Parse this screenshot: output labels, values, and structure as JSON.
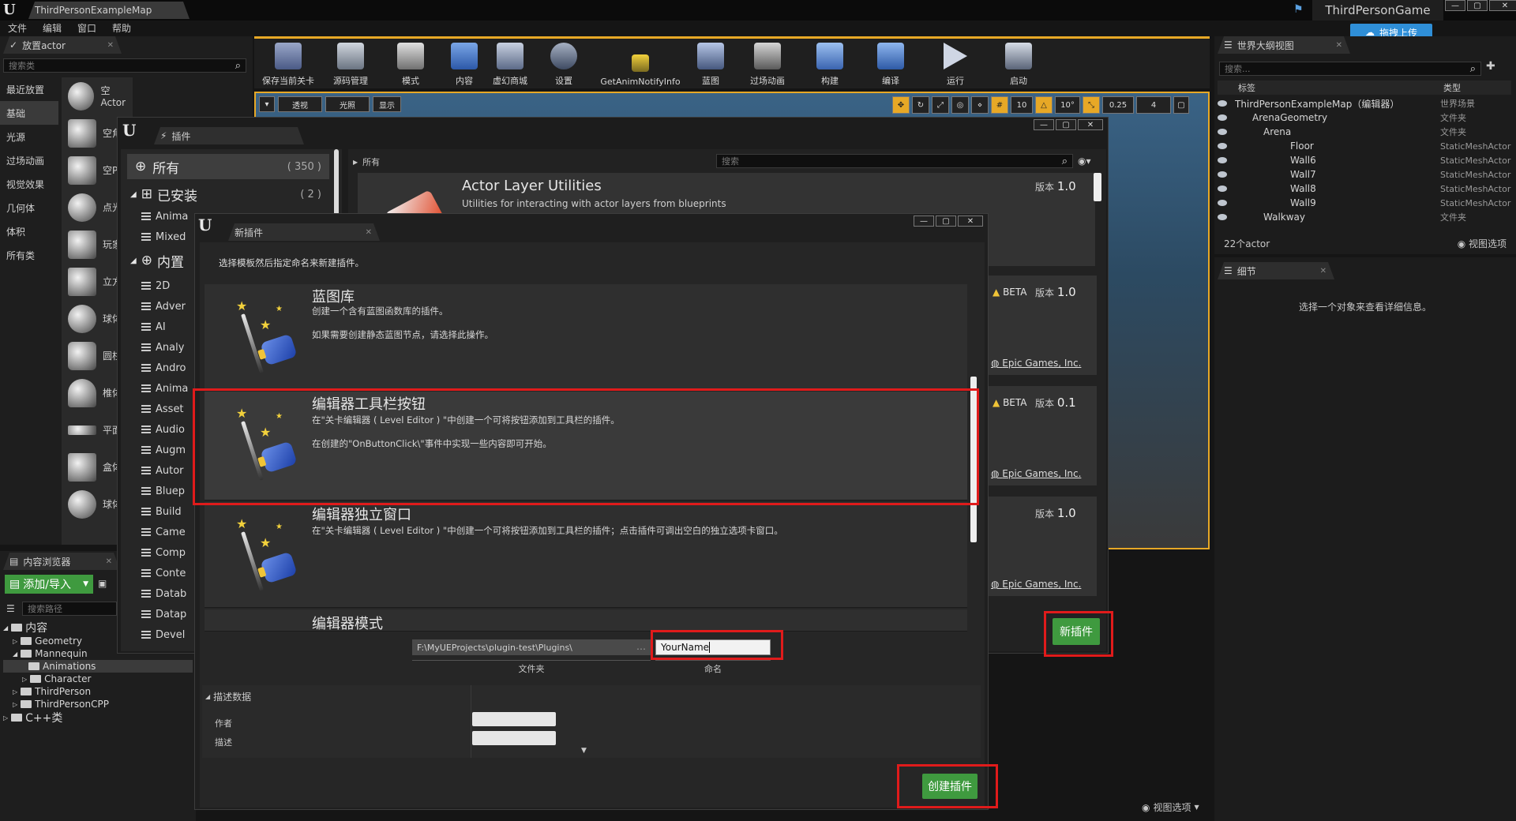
{
  "titlebar": {
    "map_tab": "ThirdPersonExampleMap",
    "project": "ThirdPersonGame",
    "upload": "拖拽上传"
  },
  "menu": [
    "文件",
    "编辑",
    "窗口",
    "帮助"
  ],
  "place_panel": {
    "tab": "放置actor",
    "search_placeholder": "搜索类",
    "categories": [
      "最近放置",
      "基础",
      "光源",
      "过场动画",
      "视觉效果",
      "几何体",
      "体积",
      "所有类"
    ],
    "items": [
      "空Actor",
      "空角",
      "空P",
      "点光",
      "玩家",
      "立方",
      "球体",
      "圆柱",
      "椎体",
      "平面",
      "盒体",
      "球体"
    ]
  },
  "toolbar": [
    "保存当前关卡",
    "源码管理",
    "模式",
    "内容",
    "虚幻商城",
    "设置",
    "GetAnimNotifyInfo",
    "蓝图",
    "过场动画",
    "构建",
    "编译",
    "运行",
    "启动"
  ],
  "viewport": {
    "perspective": "透视",
    "lit": "光照",
    "show": "显示",
    "grid": "10",
    "rot": "10°",
    "scale": "0.25",
    "cam": "4"
  },
  "plugins_window": {
    "tab": "插件",
    "all_label": "所有",
    "all_count": "( 350 )",
    "installed_label": "已安装",
    "installed_count": "( 2 )",
    "builtin_label": "内置",
    "installed_children": [
      "Anima",
      "Mixed"
    ],
    "builtin_children": [
      "2D",
      "Adver",
      "AI",
      "Analy",
      "Andro",
      "Anima",
      "Asset",
      "Audio",
      "Augm",
      "Autor",
      "Bluep",
      "Build",
      "Came",
      "Comp",
      "Conte",
      "Datab",
      "Datap",
      "Devel"
    ],
    "breadcrumb": "所有",
    "search_placeholder": "搜索",
    "first_plugin": {
      "title": "Actor Layer Utilities",
      "desc": "Utilities for interacting with actor layers from blueprints",
      "version_label": "版本",
      "version": "1.0"
    },
    "cards": [
      {
        "beta": "BETA",
        "version_label": "版本",
        "version": "1.0",
        "publisher": "Epic Games, Inc."
      },
      {
        "beta": "BETA",
        "version_label": "版本",
        "version": "0.1",
        "publisher": "Epic Games, Inc."
      },
      {
        "beta": "",
        "version_label": "版本",
        "version": "1.0",
        "publisher": "Epic Games, Inc."
      }
    ],
    "new_plugin_button": "新插件"
  },
  "new_plugin_dialog": {
    "tab": "新插件",
    "instructions": "选择模板然后指定命名来新建插件。",
    "templates": [
      {
        "title": "蓝图库",
        "desc1": "创建一个含有蓝图函数库的插件。",
        "desc2": "如果需要创建静态蓝图节点，请选择此操作。"
      },
      {
        "title": "编辑器工具栏按钮",
        "desc1": "在\"关卡编辑器 ( Level Editor ) \"中创建一个可将按钮添加到工具栏的插件。",
        "desc2": "在创建的\"OnButtonClick\\\"事件中实现一些内容即可开始。"
      },
      {
        "title": "编辑器独立窗口",
        "desc1": "在\"关卡编辑器 ( Level Editor ) \"中创建一个可将按钮添加到工具栏的插件；点击插件可调出空白的独立选项卡窗口。",
        "desc2": ""
      },
      {
        "title": "编辑器模式",
        "desc1": "",
        "desc2": ""
      }
    ],
    "path_value": "F:\\MyUEProjects\\plugin-test\\Plugins\\",
    "path_label": "文件夹",
    "name_value": "YourName",
    "name_label": "命名",
    "descriptor_header": "描述数据",
    "author_label": "作者",
    "desc_label": "描述",
    "create_button": "创建插件"
  },
  "content_browser": {
    "tab": "内容浏览器",
    "add_import": "添加/导入",
    "search_placeholder": "搜索路径",
    "root": "内容",
    "tree": [
      "Geometry",
      "Mannequin",
      "Animations",
      "Character",
      "ThirdPerson",
      "ThirdPersonCPP"
    ],
    "cpp": "C++类"
  },
  "outliner": {
    "tab": "世界大纲视图",
    "search_placeholder": "搜索...",
    "col_label": "标签",
    "col_type": "类型",
    "rows": [
      {
        "label": "ThirdPersonExampleMap（编辑器）",
        "type": "世界场景"
      },
      {
        "label": "ArenaGeometry",
        "type": "文件夹"
      },
      {
        "label": "Arena",
        "type": "文件夹"
      },
      {
        "label": "Floor",
        "type": "StaticMeshActor"
      },
      {
        "label": "Wall6",
        "type": "StaticMeshActor"
      },
      {
        "label": "Wall7",
        "type": "StaticMeshActor"
      },
      {
        "label": "Wall8",
        "type": "StaticMeshActor"
      },
      {
        "label": "Wall9",
        "type": "StaticMeshActor"
      },
      {
        "label": "Walkway",
        "type": "文件夹"
      }
    ],
    "count": "22个actor",
    "view_options": "视图选项"
  },
  "details": {
    "tab": "细节",
    "empty": "选择一个对象来查看详细信息。"
  },
  "bottom_view_options": "视图选项",
  "colors": {
    "highlight_red": "#e01b1b",
    "green_button": "#3f9a3f",
    "accent_blue": "#2f8fd8"
  }
}
